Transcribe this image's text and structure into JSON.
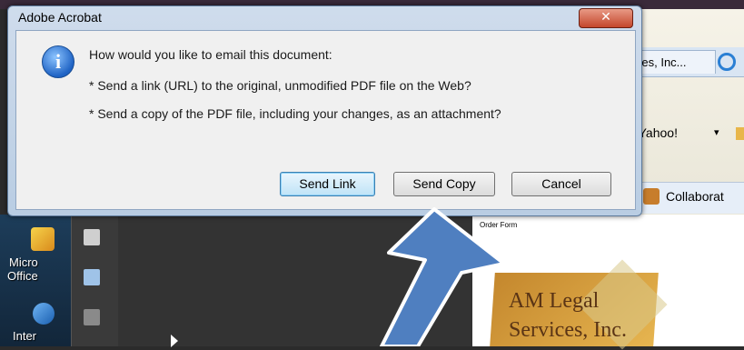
{
  "dialog": {
    "title": "Adobe Acrobat",
    "close_glyph": "✕",
    "question": "How would you like to email this document:",
    "option_link": "* Send a link (URL) to the original, unmodified PDF file on the Web?",
    "option_copy": "* Send a copy of the PDF file, including your changes, as an attachment?",
    "info_glyph": "i",
    "buttons": {
      "send_link": "Send Link",
      "send_copy": "Send Copy",
      "cancel": "Cancel"
    }
  },
  "browser": {
    "tab_label": "ices, Inc...",
    "toolbar_text": "y Yahoo!",
    "caret": "▾",
    "collab_label": "Collaborat"
  },
  "desktop": {
    "icon1_line1": "Micro",
    "icon1_line2": "Office",
    "icon2_label": "Inter"
  },
  "document": {
    "title": "Order Form",
    "logo_line1": "AM Legal",
    "logo_line2": "Services, Inc."
  },
  "colors": {
    "dialog_bg": "#f0f0f0",
    "default_button": "#3c7fb1",
    "arrow_fill": "#4f7fc0"
  }
}
